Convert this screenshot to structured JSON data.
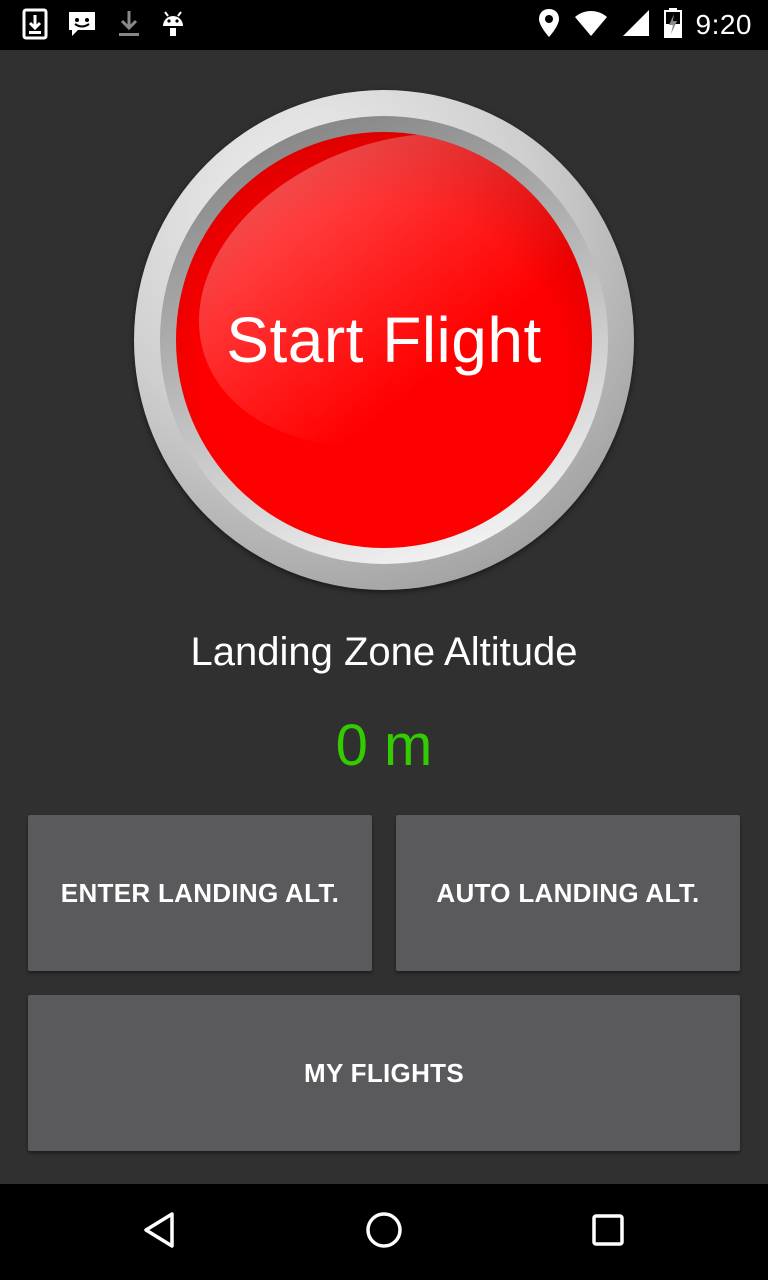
{
  "status_bar": {
    "time": "9:20",
    "left_icons": [
      "download-box-icon",
      "messenger-icon",
      "download-icon",
      "android-debug-icon"
    ],
    "right_icons": [
      "location-icon",
      "wifi-icon",
      "cell-signal-icon",
      "battery-charging-icon"
    ]
  },
  "main": {
    "start_button_label": "Start Flight",
    "landing_zone_title": "Landing Zone Altitude",
    "landing_zone_value": "0 m",
    "enter_landing_label": "ENTER LANDING ALT.",
    "auto_landing_label": "AUTO LANDING ALT.",
    "my_flights_label": "MY FLIGHTS"
  },
  "nav_bar": {
    "icons": [
      "back-icon",
      "home-icon",
      "recents-icon"
    ]
  },
  "colors": {
    "background": "#303030",
    "button_bg": "#5a5a5c",
    "start_red": "#ff0000",
    "altitude_value": "#33cc00"
  }
}
